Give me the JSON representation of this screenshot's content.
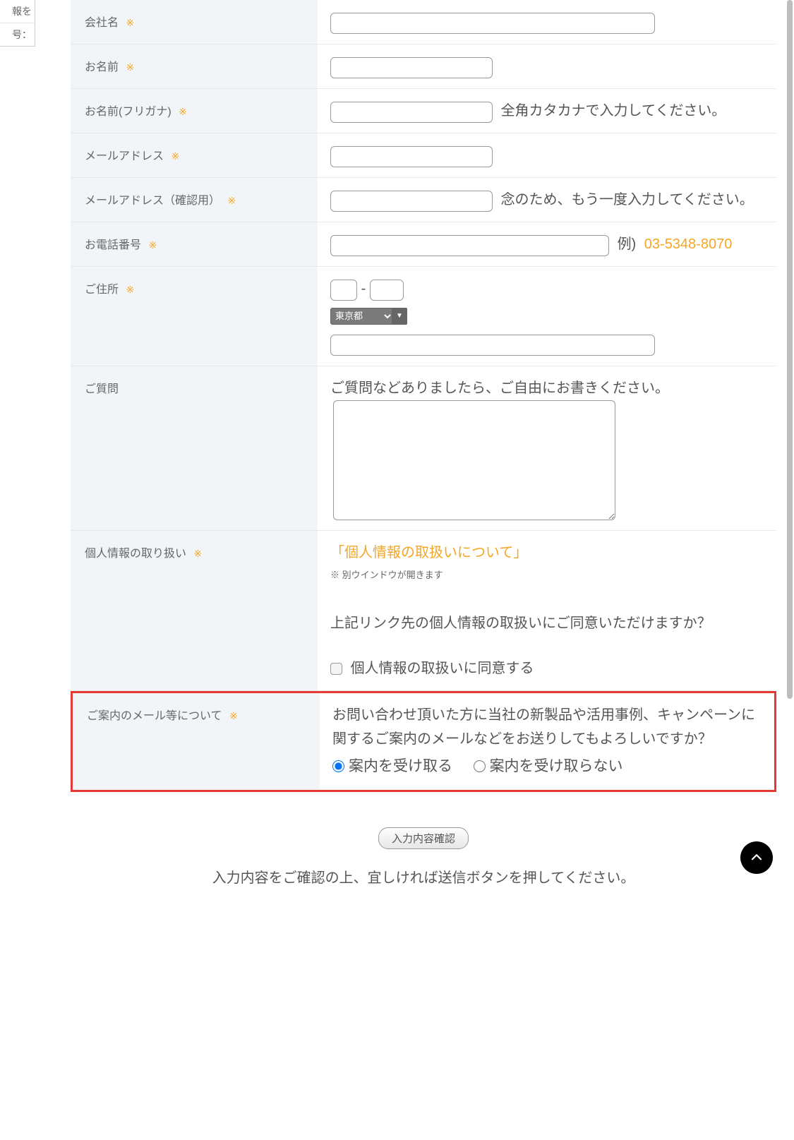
{
  "required_mark": "※",
  "sidebar_fragments": {
    "top": "報を",
    "bottom": "号："
  },
  "fields": {
    "company": {
      "label": "会社名"
    },
    "name": {
      "label": "お名前"
    },
    "kana": {
      "label": "お名前(フリガナ)",
      "hint": "全角カタカナで入力してください。"
    },
    "email": {
      "label": "メールアドレス"
    },
    "email2": {
      "label": "メールアドレス（確認用）",
      "hint": "念のため、もう一度入力してください。"
    },
    "phone": {
      "label": "お電話番号",
      "ex_prefix": "例) ",
      "ex_value": "03-5348-8070"
    },
    "address": {
      "label": "ご住所",
      "zip_sep": "-",
      "pref_selected": "東京都"
    },
    "question": {
      "label": "ご質問",
      "hint": "ご質問などありましたら、ご自由にお書きください。"
    },
    "privacy": {
      "label": "個人情報の取り扱い",
      "link": "「個人情報の取扱いについて」",
      "note": "※ 別ウインドウが開きます",
      "consent_q": "上記リンク先の個人情報の取扱いにご同意いただけますか？",
      "checkbox_label": "個人情報の取扱いに同意する"
    },
    "optin": {
      "label": "ご案内のメール等について",
      "question": "お問い合わせ頂いた方に当社の新製品や活用事例、キャンペーンに関するご案内のメールなどをお送りしてもよろしいですか？",
      "opt_yes": "案内を受け取る",
      "opt_no": "案内を受け取らない"
    }
  },
  "submit_label": "入力内容確認",
  "footnote": "入力内容をご確認の上、宜しければ送信ボタンを押してください。"
}
